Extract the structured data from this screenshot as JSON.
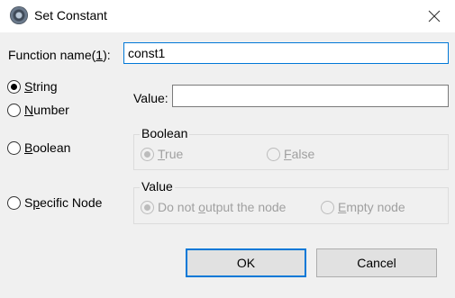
{
  "window": {
    "title": "Set Constant",
    "app_icon": "settings-gear-icon",
    "close_icon": "close-icon"
  },
  "function_name": {
    "label_prefix": "Function name(",
    "label_mnemonic": "1",
    "label_suffix": "):",
    "value": "const1"
  },
  "types": {
    "string": {
      "mnemonic": "S",
      "rest": "tring",
      "checked": true
    },
    "number": {
      "mnemonic": "N",
      "rest": "umber",
      "checked": false
    },
    "boolean": {
      "mnemonic": "B",
      "rest": "oolean",
      "checked": false
    },
    "specific_node": {
      "prefix": "S",
      "mnemonic": "p",
      "rest": "ecific Node",
      "checked": false
    }
  },
  "string_value": {
    "label": "Value:",
    "value": ""
  },
  "boolean_group": {
    "title": "Boolean",
    "true_option": {
      "mnemonic": "T",
      "rest": "rue",
      "checked": true,
      "enabled": false
    },
    "false_option": {
      "mnemonic": "F",
      "rest": "alse",
      "checked": false,
      "enabled": false
    }
  },
  "node_group": {
    "title": "Value",
    "do_not_output": {
      "prefix": "Do not ",
      "mnemonic": "o",
      "rest": "utput the node",
      "checked": true,
      "enabled": false
    },
    "empty_node": {
      "mnemonic": "E",
      "rest": "mpty node",
      "checked": false,
      "enabled": false
    }
  },
  "buttons": {
    "ok_label": "OK",
    "cancel_label": "Cancel"
  }
}
